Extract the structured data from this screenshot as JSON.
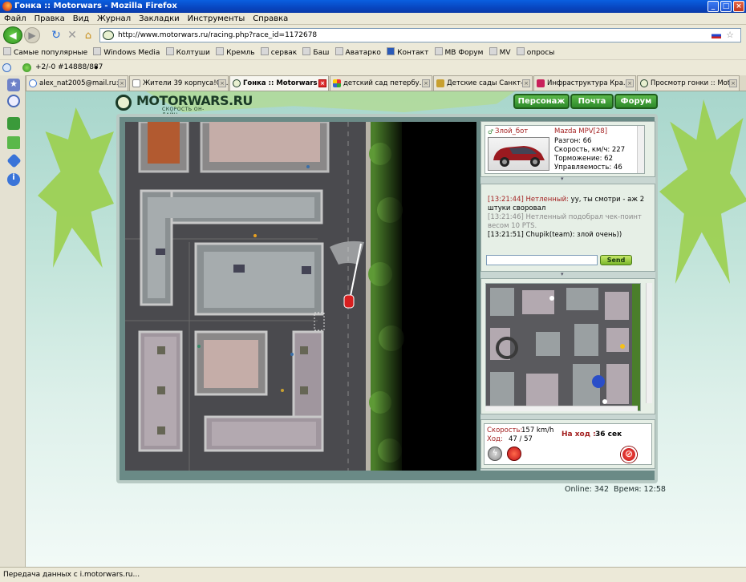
{
  "window": {
    "title": "Гонка :: Motorwars - Mozilla Firefox"
  },
  "menu": [
    "Файл",
    "Правка",
    "Вид",
    "Журнал",
    "Закладки",
    "Инструменты",
    "Справка"
  ],
  "url": "http://www.motorwars.ru/racing.php?race_id=1172678",
  "bookmarks": [
    "Самые популярные",
    "Windows Media",
    "Колтуши",
    "Кремль",
    "сервак",
    "Баш",
    "Аватарко",
    "Контакт",
    "MB Форум",
    "MV",
    "опросы"
  ],
  "addon_bar": {
    "score": "+2/-0",
    "id": "#14888/887"
  },
  "tabs": [
    {
      "label": "alex_nat2005@mail.ru:...",
      "active": false
    },
    {
      "label": "Жители 39 корпуса!О...",
      "active": false
    },
    {
      "label": "Гонка :: Motorwars",
      "active": true
    },
    {
      "label": "детский сад петербу...",
      "active": false
    },
    {
      "label": "Детские сады Санкт-...",
      "active": false
    },
    {
      "label": "Инфраструктура Кра...",
      "active": false
    },
    {
      "label": "Просмотр гонки :: Mot...",
      "active": false
    }
  ],
  "site": {
    "logo": "MOTORWARS.RU",
    "tagline": "СКОРОСТЬ ОН-ЛАЙН",
    "nav": [
      "Персонаж",
      "Почта",
      "Форум"
    ]
  },
  "player": {
    "name": "Злой_бот",
    "car": "Mazda MPV[28]",
    "stats": [
      "Разгон: 66",
      "Скорость, км/ч: 227",
      "Торможение: 62",
      "Управляемость: 46"
    ]
  },
  "chat": {
    "messages": [
      {
        "time": "[13:21:44]",
        "author": "Нетленный:",
        "text": "уу, ты смотри - аж 2 штуки своровал",
        "style": "normal"
      },
      {
        "time": "[13:21:46]",
        "author": "",
        "text": "Нетленный подобрал чек-поинт весом 10 PTS.",
        "style": "system"
      },
      {
        "time": "[13:21:51]",
        "author": "Chupik(team):",
        "text": "злой очень))",
        "style": "team"
      }
    ],
    "input_value": "",
    "send_label": "Send"
  },
  "race": {
    "speed_label": "Скорость:",
    "speed_value": "157 km/h",
    "move_label": "Ход:",
    "move_value": "47 / 57",
    "turn_label": "На ход :",
    "turn_value": "36 сек"
  },
  "footer": {
    "online": "Online: 342",
    "time": "Время: 12:58"
  },
  "status": "Передача данных с i.motorwars.ru..."
}
